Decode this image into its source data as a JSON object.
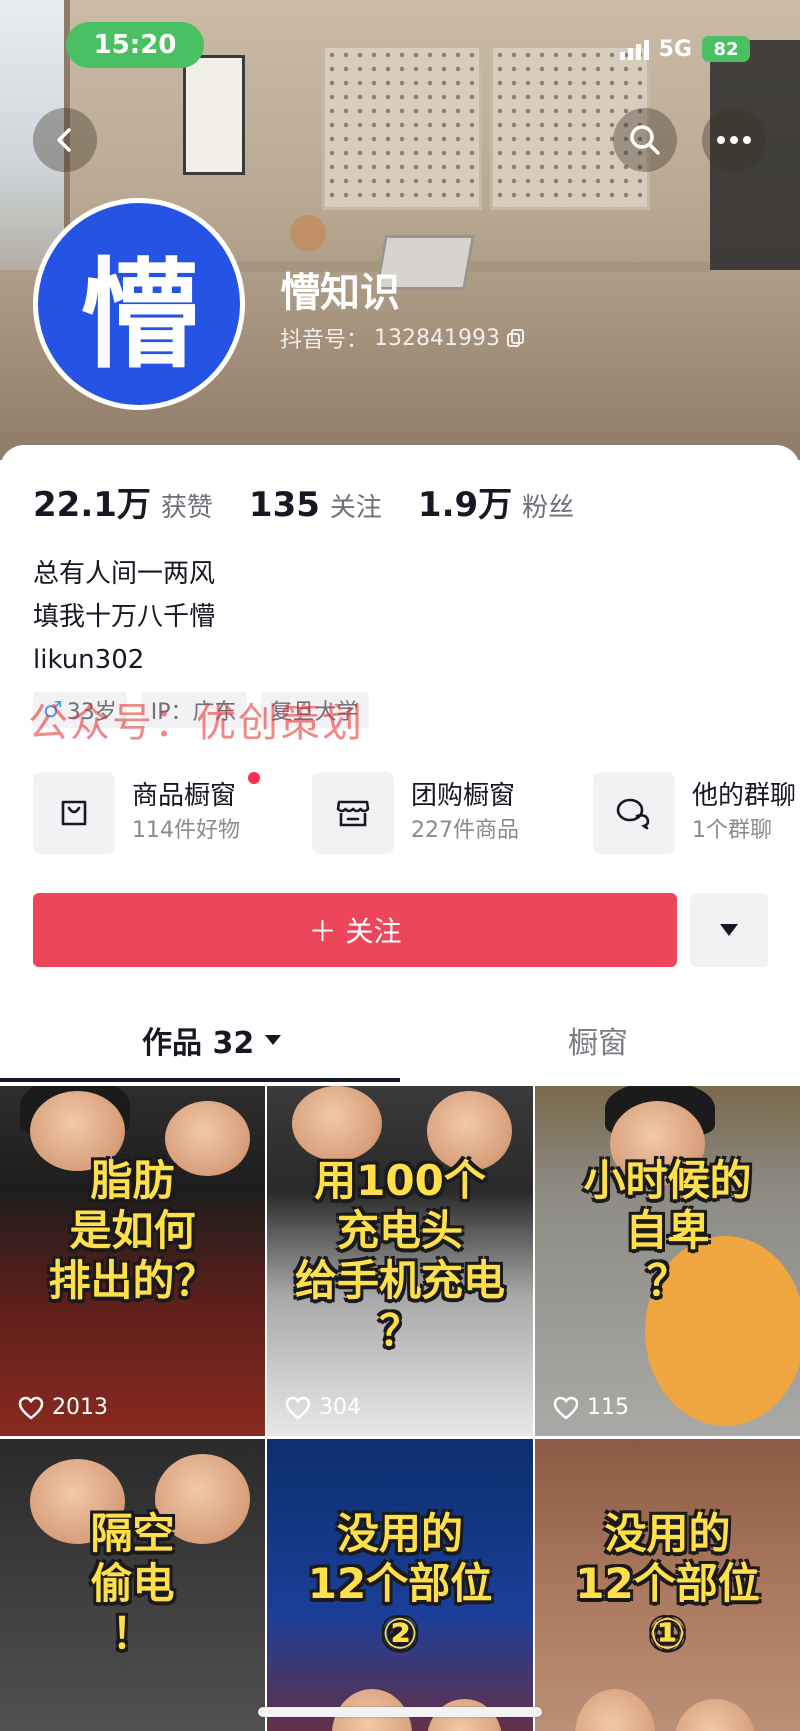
{
  "status_bar": {
    "time": "15:20",
    "network": "5G",
    "battery": "82"
  },
  "colors": {
    "accent": "#ed4559",
    "avatar_bg": "#2553e4",
    "status_green": "#49c162",
    "caption_yellow": "#ffe04a"
  },
  "profile": {
    "avatar_char": "懵",
    "name": "懵知识",
    "douyin_id_label": "抖音号：",
    "douyin_id": "132841993",
    "stats": [
      {
        "num": "22.1万",
        "label": "获赞"
      },
      {
        "num": "135",
        "label": "关注"
      },
      {
        "num": "1.9万",
        "label": "粉丝"
      }
    ],
    "bio": [
      "总有人间一两风",
      "填我十万八千懵",
      "likun302"
    ],
    "tags": {
      "gender_symbol": "♂",
      "age": "33岁",
      "ip": "IP：广东",
      "school": "复旦大学"
    }
  },
  "features": [
    {
      "title": "商品橱窗",
      "sub": "114件好物",
      "icon": "shopping-bag-icon"
    },
    {
      "title": "团购橱窗",
      "sub": "227件商品",
      "icon": "store-icon"
    },
    {
      "title": "他的群聊",
      "sub": "1个群聊",
      "icon": "chat-bubbles-icon"
    }
  ],
  "follow_button": "＋ 关注",
  "tabs": {
    "works": "作品 32",
    "showcase": "橱窗"
  },
  "watermark": "公众号：优创策划",
  "videos": [
    {
      "caption": "脂肪\n是如何\n排出的？",
      "likes": "2013"
    },
    {
      "caption": "用100个\n充电头\n给手机充电\n？",
      "likes": "304"
    },
    {
      "caption": "小时候的\n自卑\n？",
      "likes": "115"
    },
    {
      "caption": "隔空\n偷电\n！",
      "likes": ""
    },
    {
      "caption": "没用的\n12个部位\n②",
      "likes": ""
    },
    {
      "caption": "没用的\n12个部位\n①",
      "likes": ""
    }
  ]
}
